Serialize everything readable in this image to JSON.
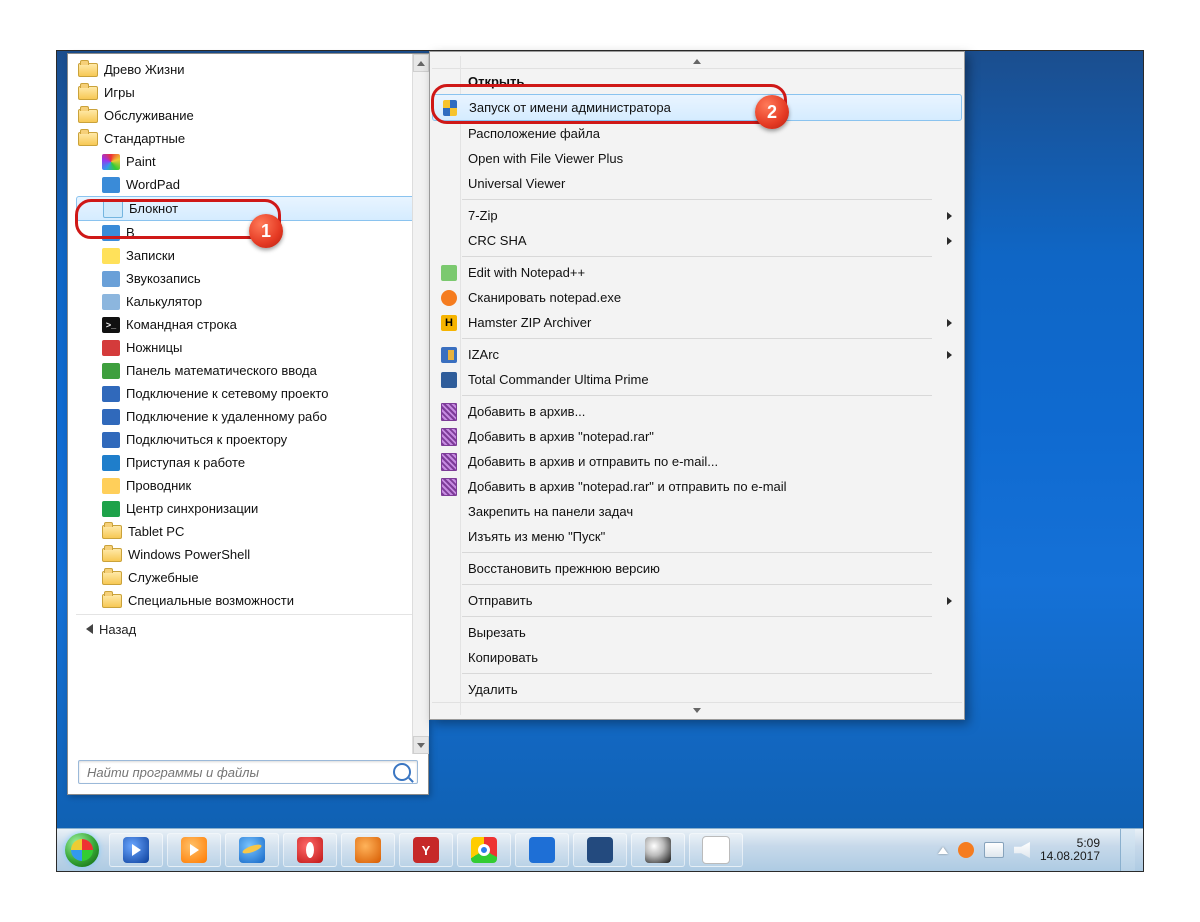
{
  "start_menu": {
    "folders_top": [
      "Древо Жизни",
      "Игры",
      "Обслуживание",
      "Стандартные"
    ],
    "apps": [
      {
        "label": "Paint",
        "icon": "paint"
      },
      {
        "label": "WordPad",
        "icon": "wordpad"
      },
      {
        "label": "Блокнот",
        "icon": "notepad",
        "selected": true,
        "badge": 1
      },
      {
        "label": "В",
        "icon": "app"
      },
      {
        "label": "Записки",
        "icon": "sticky"
      },
      {
        "label": "Звукозапись",
        "icon": "rec"
      },
      {
        "label": "Калькулятор",
        "icon": "calc"
      },
      {
        "label": "Командная строка",
        "icon": "cmd"
      },
      {
        "label": "Ножницы",
        "icon": "snip"
      },
      {
        "label": "Панель математического ввода",
        "icon": "math"
      },
      {
        "label": "Подключение к сетевому проекто",
        "icon": "proj1"
      },
      {
        "label": "Подключение к удаленному рабо",
        "icon": "proj2"
      },
      {
        "label": "Подключиться к проектору",
        "icon": "proj3"
      },
      {
        "label": "Приступая к работе",
        "icon": "gs"
      },
      {
        "label": "Проводник",
        "icon": "expl"
      },
      {
        "label": "Центр синхронизации",
        "icon": "sync"
      }
    ],
    "folders_bottom": [
      "Tablet PC",
      "Windows PowerShell",
      "Служебные",
      "Специальные возможности"
    ],
    "back": "Назад",
    "search_placeholder": "Найти программы и файлы"
  },
  "context_menu": {
    "items": [
      {
        "label": "Открыть",
        "bold": true
      },
      {
        "label": "Запуск от имени администратора",
        "icon": "shield",
        "highlight": true,
        "badge": 2
      },
      {
        "label": "Расположение файла"
      },
      {
        "label": "Open with File Viewer Plus"
      },
      {
        "label": "Universal Viewer"
      },
      {
        "sep": true
      },
      {
        "label": "7-Zip",
        "submenu": true
      },
      {
        "label": "CRC SHA",
        "submenu": true
      },
      {
        "sep": true
      },
      {
        "label": "Edit with Notepad++",
        "icon": "npp"
      },
      {
        "label": "Сканировать notepad.exe",
        "icon": "avast"
      },
      {
        "label": "Hamster ZIP Archiver",
        "icon": "h",
        "submenu": true
      },
      {
        "sep": true
      },
      {
        "label": "IZArc",
        "icon": "iz",
        "submenu": true
      },
      {
        "label": "Total Commander Ultima Prime",
        "icon": "tc"
      },
      {
        "sep": true
      },
      {
        "label": "Добавить в архив...",
        "icon": "rar"
      },
      {
        "label": "Добавить в архив \"notepad.rar\"",
        "icon": "rar"
      },
      {
        "label": "Добавить в архив и отправить по e-mail...",
        "icon": "rar"
      },
      {
        "label": "Добавить в архив \"notepad.rar\" и отправить по e-mail",
        "icon": "rar"
      },
      {
        "label": "Закрепить на панели задач"
      },
      {
        "label": "Изъять из меню \"Пуск\""
      },
      {
        "sep": true
      },
      {
        "label": "Восстановить прежнюю версию"
      },
      {
        "sep": true
      },
      {
        "label": "Отправить",
        "submenu": true
      },
      {
        "sep": true
      },
      {
        "label": "Вырезать"
      },
      {
        "label": "Копировать"
      },
      {
        "sep": true
      },
      {
        "label": "Удалить"
      }
    ]
  },
  "taskbar": {
    "buttons": [
      "wmp",
      "wmpo",
      "ie",
      "opera",
      "ff",
      "yb",
      "ch",
      "mx",
      "tc",
      "ball",
      "doc"
    ],
    "clock": {
      "time": "5:09",
      "date": "14.08.2017"
    }
  }
}
